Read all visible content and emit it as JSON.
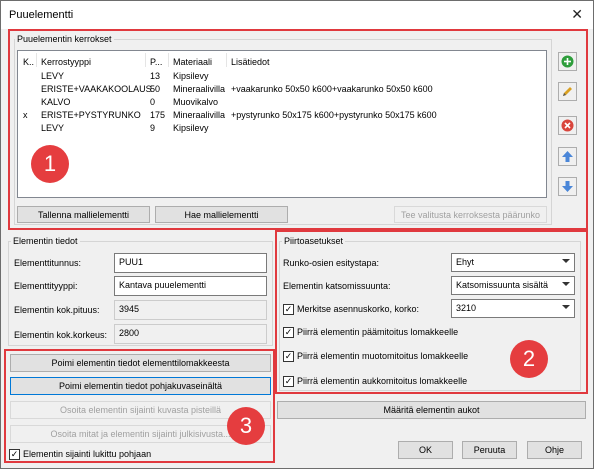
{
  "window": {
    "title": "Puuelementti",
    "close_glyph": "✕"
  },
  "layers": {
    "group_label": "Puuelementin kerrokset",
    "columns": [
      "K..",
      "Kerrostyyppi",
      "P...",
      "Materiaali",
      "Lisätiedot"
    ],
    "rows": [
      {
        "k": "",
        "type": "LEVY",
        "p": "13",
        "material": "Kipsilevy",
        "info": ""
      },
      {
        "k": "",
        "type": "ERISTE+VAAKAKOOLAUS",
        "p": "50",
        "material": "Mineraalivilla",
        "info": "+vaakarunko 50x50 k600+vaakarunko 50x50 k600"
      },
      {
        "k": "",
        "type": "KALVO",
        "p": "0",
        "material": "Muovikalvo",
        "info": ""
      },
      {
        "k": "x",
        "type": "ERISTE+PYSTYRUNKO",
        "p": "175",
        "material": "Mineraalivilla",
        "info": "+pystyrunko 50x175 k600+pystyrunko 50x175 k600"
      },
      {
        "k": "",
        "type": "LEVY",
        "p": "9",
        "material": "Kipsilevy",
        "info": ""
      }
    ],
    "save_template": "Tallenna mallielementti",
    "load_template": "Hae mallielementti",
    "make_main_frame": "Tee valitusta kerroksesta päärunko"
  },
  "side_buttons": [
    {
      "icon": "add-icon",
      "color": "#2e9e3c"
    },
    {
      "icon": "edit-pencil-icon",
      "color": "#d9a021"
    },
    {
      "icon": "delete-icon",
      "color": "#d9463d"
    },
    {
      "icon": "move-up-icon",
      "color": "#4a86d8"
    },
    {
      "icon": "move-down-icon",
      "color": "#4a86d8"
    }
  ],
  "element_info": {
    "group_label": "Elementin tiedot",
    "id_label": "Elementtitunnus:",
    "id_value": "PUU1",
    "type_label": "Elementtityyppi:",
    "type_value": "Kantava puuelementti",
    "length_label": "Elementin kok.pituus:",
    "length_value": "3945",
    "height_label": "Elementin kok.korkeus:",
    "height_value": "2800"
  },
  "left_actions": {
    "pick_form": "Poimi elementin tiedot elementtilomakkeesta",
    "pick_plan": "Poimi elementin tiedot pohjakuvaseinältä",
    "point_location": "Osoita elementin sijainti kuvasta pisteillä",
    "point_dims": "Osoita mitat ja elementin sijainti julkisivusta...",
    "lock_label": "Elementin sijainti lukittu pohjaan"
  },
  "draw_settings": {
    "group_label": "Piirtoasetukset",
    "runko_label": "Runko-osien esitystapa:",
    "runko_value": "Ehyt",
    "view_label": "Elementin katsomissuunta:",
    "view_value": "Katsomissuunta sisältä",
    "mount_label": "Merkitse asennuskorko, korko:",
    "mount_value": "3210",
    "cb1": "Piirrä elementin päämitoitus lomakkeelle",
    "cb2": "Piirrä elementin muotomitoitus lomakkeelle",
    "cb3": "Piirrä elementin aukkomitoitus lomakkeelle",
    "openings_btn": "Määritä elementin aukot"
  },
  "footer": {
    "ok": "OK",
    "cancel": "Peruuta",
    "help": "Ohje"
  },
  "annotations": {
    "one": "1",
    "two": "2",
    "three": "3"
  },
  "check_glyph": "✓",
  "accent": "#e0393e"
}
